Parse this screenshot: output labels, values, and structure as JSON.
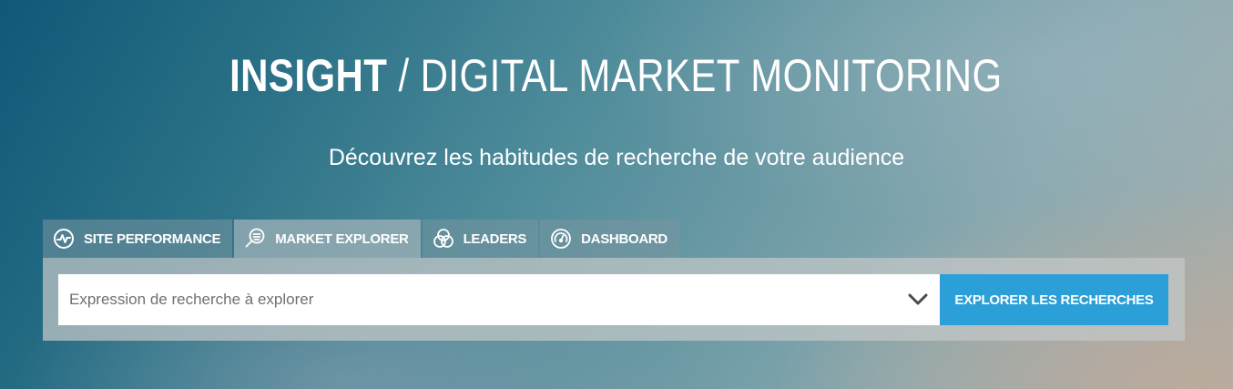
{
  "hero": {
    "brand": "INSIGHT",
    "separator": " / ",
    "tagline": "DIGITAL MARKET MONITORING",
    "subtitle": "Découvrez les habitudes de recherche de votre audience"
  },
  "tabs": [
    {
      "label": "SITE PERFORMANCE",
      "icon": "pulse-icon",
      "active": false
    },
    {
      "label": "MARKET EXPLORER",
      "icon": "magnifier-list-icon",
      "active": true
    },
    {
      "label": "LEADERS",
      "icon": "venn-circles-icon",
      "active": false
    },
    {
      "label": "DASHBOARD",
      "icon": "gauge-icon",
      "active": false
    }
  ],
  "search": {
    "value": "",
    "placeholder": "Expression de recherche à explorer",
    "dropdown_icon": "chevron-down-icon",
    "submit_label": "EXPLORER LES RECHERCHES"
  },
  "colors": {
    "accent": "#2b9fd8",
    "text": "#ffffff"
  }
}
